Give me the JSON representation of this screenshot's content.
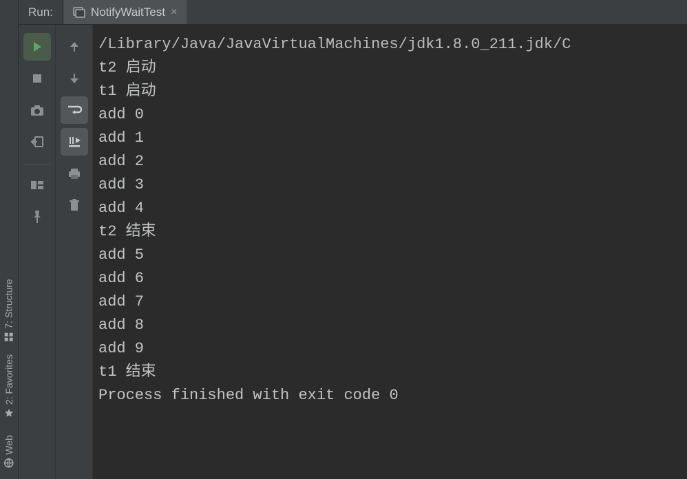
{
  "header": {
    "run_label": "Run:",
    "tab": {
      "title": "NotifyWaitTest",
      "close": "×"
    }
  },
  "rail": {
    "structure": "7: Structure",
    "favorites": "2: Favorites",
    "web": "Web"
  },
  "console": {
    "lines": [
      "/Library/Java/JavaVirtualMachines/jdk1.8.0_211.jdk/C",
      "t2 启动",
      "t1 启动",
      "add 0",
      "add 1",
      "add 2",
      "add 3",
      "add 4",
      "t2 结束",
      "add 5",
      "add 6",
      "add 7",
      "add 8",
      "add 9",
      "t1 结束",
      "",
      "Process finished with exit code 0"
    ]
  }
}
